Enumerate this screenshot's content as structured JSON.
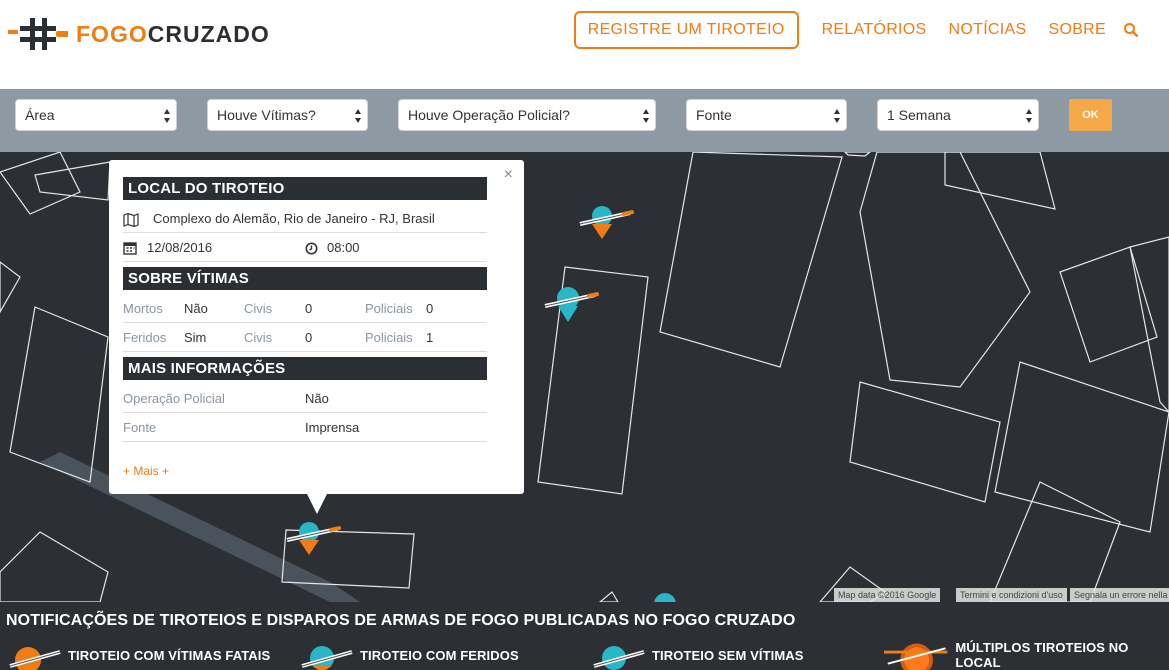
{
  "header": {
    "logo": {
      "part1": "FOGO",
      "part2": "CRUZADO"
    },
    "nav": {
      "register": "REGISTRE UM TIROTEIO",
      "reports": "RELATÓRIOS",
      "news": "NOTÍCIAS",
      "about": "SOBRE"
    }
  },
  "filters": {
    "area": "Área",
    "victims": "Houve Vítimas?",
    "police": "Houve Operação Policial?",
    "source": "Fonte",
    "period": "1 Semana",
    "ok": "OK"
  },
  "popup": {
    "close": "×",
    "location_title": "LOCAL DO TIROTEIO",
    "address": "Complexo do Alemão, Rio de Janeiro - RJ, Brasil",
    "date": "12/08/2016",
    "time": "08:00",
    "victims_title": "SOBRE VÍTIMAS",
    "dead_label": "Mortos",
    "dead_value": "Não",
    "dead_civ_label": "Civis",
    "dead_civ_value": "0",
    "dead_pol_label": "Policiais",
    "dead_pol_value": "0",
    "inj_label": "Feridos",
    "inj_value": "Sim",
    "inj_civ_label": "Civis",
    "inj_civ_value": "0",
    "inj_pol_label": "Policiais",
    "inj_pol_value": "1",
    "more_title": "MAIS INFORMAÇÕES",
    "op_label": "Operação Policial",
    "op_value": "Não",
    "src_label": "Fonte",
    "src_value": "Imprensa",
    "more_link": "+ Mais +"
  },
  "map": {
    "attribution": [
      "Map data ©2016 Google",
      "Termini e condizioni d'uso",
      "Segnala un errore nella mappa"
    ]
  },
  "legend": {
    "title": "NOTIFICAÇÕES DE TIROTEIOS E DISPAROS DE ARMAS DE FOGO PUBLICADAS NO FOGO CRUZADO",
    "items": [
      "TIROTEIO COM VÍTIMAS FATAIS",
      "TIROTEIO COM FERIDOS",
      "TIROTEIO SEM VÍTIMAS",
      "MÚLTIPLOS TIROTEIOS NO LOCAL"
    ]
  },
  "colors": {
    "accent": "#f07c14",
    "teal": "#29b6c6",
    "dark": "#2c2f33",
    "filterbar": "#8d99a3",
    "ok": "#f5a847"
  }
}
